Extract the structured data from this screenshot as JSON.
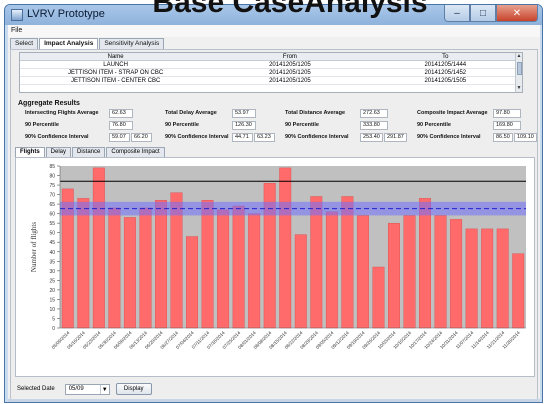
{
  "overlay_title": "Base CaseAnalysis",
  "window": {
    "title": "LVRV Prototype",
    "controls": {
      "minimize": "–",
      "maximize": "□",
      "close": "✕"
    }
  },
  "menubar": {
    "file": "File"
  },
  "tabs": [
    {
      "label": "Select",
      "active": false
    },
    {
      "label": "Impact Analysis",
      "active": true
    },
    {
      "label": "Sensitivity Analysis",
      "active": false
    }
  ],
  "table": {
    "headers": [
      "Name",
      "From",
      "To"
    ],
    "rows": [
      [
        "LAUNCH",
        "20141205/1205",
        "20141205/1444"
      ],
      [
        "JETTISON ITEM - STRAP ON CBC",
        "20141205/1205",
        "20141205/1452"
      ],
      [
        "JETTISON ITEM - CENTER CBC",
        "20141205/1205",
        "20141205/1505"
      ]
    ]
  },
  "aggregate": {
    "title": "Aggregate Results",
    "groups": [
      {
        "avg_label": "Intersecting Flights Average",
        "avg": "62.63",
        "p90_label": "90 Percentile",
        "p90": "76.80",
        "ci_label": "90% Confidence Interval",
        "ci_low": "59.07",
        "ci_high": "66.20"
      },
      {
        "avg_label": "Total Delay Average",
        "avg": "53.97",
        "p90_label": "90 Percentile",
        "p90": "126.30",
        "ci_label": "90% Confidence Interval",
        "ci_low": "44.71",
        "ci_high": "63.23"
      },
      {
        "avg_label": "Total Distance Average",
        "avg": "272.63",
        "p90_label": "90 Percentile",
        "p90": "333.80",
        "ci_label": "90% Confidence Interval",
        "ci_low": "253.40",
        "ci_high": "291.87"
      },
      {
        "avg_label": "Composite Impact Average",
        "avg": "97.80",
        "p90_label": "90 Percentile",
        "p90": "169.80",
        "ci_label": "90% Confidence Interval",
        "ci_low": "86.50",
        "ci_high": "109.10"
      }
    ]
  },
  "chart_tabs": [
    {
      "label": "Flights",
      "active": true
    },
    {
      "label": "Delay",
      "active": false
    },
    {
      "label": "Distance",
      "active": false
    },
    {
      "label": "Composite Impact",
      "active": false
    }
  ],
  "chart_data": {
    "type": "bar",
    "ylabel": "Number of flights",
    "ylim": [
      0,
      85
    ],
    "yticks": [
      0,
      5,
      10,
      15,
      20,
      25,
      30,
      35,
      40,
      45,
      50,
      55,
      60,
      65,
      70,
      75,
      80,
      85
    ],
    "categories": [
      "05/09/2014",
      "05/16/2014",
      "05/23/2014",
      "05/30/2014",
      "06/06/2014",
      "06/13/2014",
      "06/20/2014",
      "06/27/2014",
      "07/04/2014",
      "07/11/2014",
      "07/18/2014",
      "07/25/2014",
      "08/01/2014",
      "08/08/2014",
      "08/15/2014",
      "08/22/2014",
      "08/29/2014",
      "09/05/2014",
      "09/12/2014",
      "09/19/2014",
      "09/26/2014",
      "10/03/2014",
      "10/10/2014",
      "10/17/2014",
      "10/24/2014",
      "10/31/2014",
      "11/07/2014",
      "11/14/2014",
      "11/21/2014",
      "11/28/2014"
    ],
    "values": [
      73,
      68,
      84,
      63,
      58,
      63,
      67,
      71,
      48,
      67,
      62,
      64,
      60,
      76,
      84,
      49,
      69,
      61,
      69,
      59,
      32,
      55,
      59,
      68,
      59,
      57,
      52,
      52,
      52,
      39
    ],
    "reference_line": 77,
    "mean_line": 62.63,
    "band": [
      59.07,
      66.2
    ],
    "colors": {
      "bar": "#ff6b6b",
      "bar_stroke": "#d84a4a",
      "band": "#7070ff",
      "mean": "#2222cc",
      "reference": "#000000",
      "plot_bg": "#c0c0c0"
    },
    "grid": false
  },
  "footer": {
    "date_label": "Selected Date",
    "date_value": "05/09",
    "button": "Display"
  }
}
